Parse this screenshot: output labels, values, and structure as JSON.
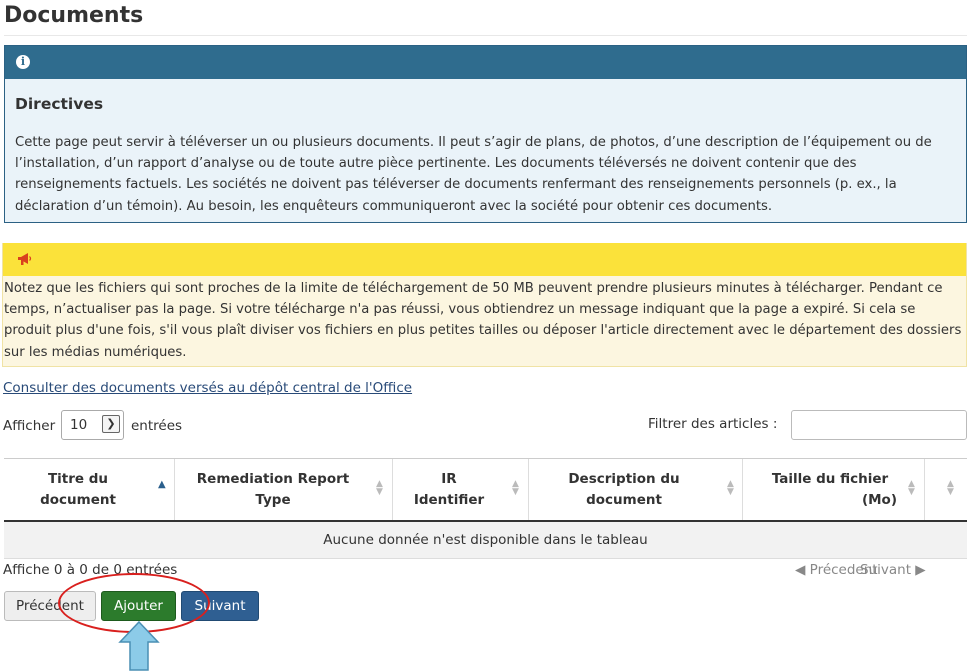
{
  "page": {
    "title": "Documents"
  },
  "info_panel": {
    "icon": "info-icon",
    "title": "Directives",
    "text": "Cette page peut servir à téléverser un ou plusieurs documents. Il peut s’agir de plans, de photos, d’une description de l’équipement ou de l’installation, d’un rapport d’analyse ou de toute autre pièce pertinente. Les documents téléversés ne doivent contenir que des renseignements factuels. Les sociétés ne doivent pas téléverser de documents renfermant des renseignements personnels (p. ex., la déclaration d’un témoin). Au besoin, les enquêteurs communiqueront avec la société pour obtenir ces documents."
  },
  "warning_panel": {
    "icon": "megaphone-icon",
    "text": "Notez que les fichiers qui sont proches de la limite de téléchargement de 50 MB peuvent prendre plusieurs minutes à télécharger. Pendant ce temps, n’actualiser pas la page. Si votre télécharge n'a pas réussi, vous obtiendrez un message indiquant que la page a expiré. Si cela se produit plus d'une fois, s'il vous plaît diviser vos fichiers en plus petites tailles ou déposer l'article directement avec le département des dossiers sur les médias numériques."
  },
  "central_link": "Consulter des documents versés au dépôt central de l'Office",
  "table_controls": {
    "show_label": "Afficher",
    "length_value": "10",
    "entries_label": "entrées",
    "filter_label": "Filtrer des articles :",
    "filter_value": ""
  },
  "table": {
    "columns": [
      {
        "line1": "Titre du",
        "line2": "document"
      },
      {
        "line1": "Remediation Report",
        "line2": "Type"
      },
      {
        "line1": "IR",
        "line2": "Identifier"
      },
      {
        "line1": "Description du",
        "line2": "document"
      },
      {
        "line1": "Taille du fichier",
        "line2": "(Mo)"
      }
    ],
    "empty_message": "Aucune donnée n'est disponible dans le tableau",
    "info": "Affiche 0 à 0 de 0 entrées",
    "pager_prev": "◀ Précedent",
    "pager_next": "Suivant ▶"
  },
  "buttons": {
    "previous": "Précédent",
    "add": "Ajouter",
    "next": "Suivant"
  },
  "colors": {
    "info_header": "#2f6c8e",
    "info_bg": "#eaf3f9",
    "warning_header": "#fbe23a",
    "warning_bg": "#fcf6e0",
    "add_button": "#2c7b2c",
    "next_button": "#2f5f92",
    "annotation_circle": "#d9201e",
    "annotation_arrow": "#8ccbe8"
  }
}
